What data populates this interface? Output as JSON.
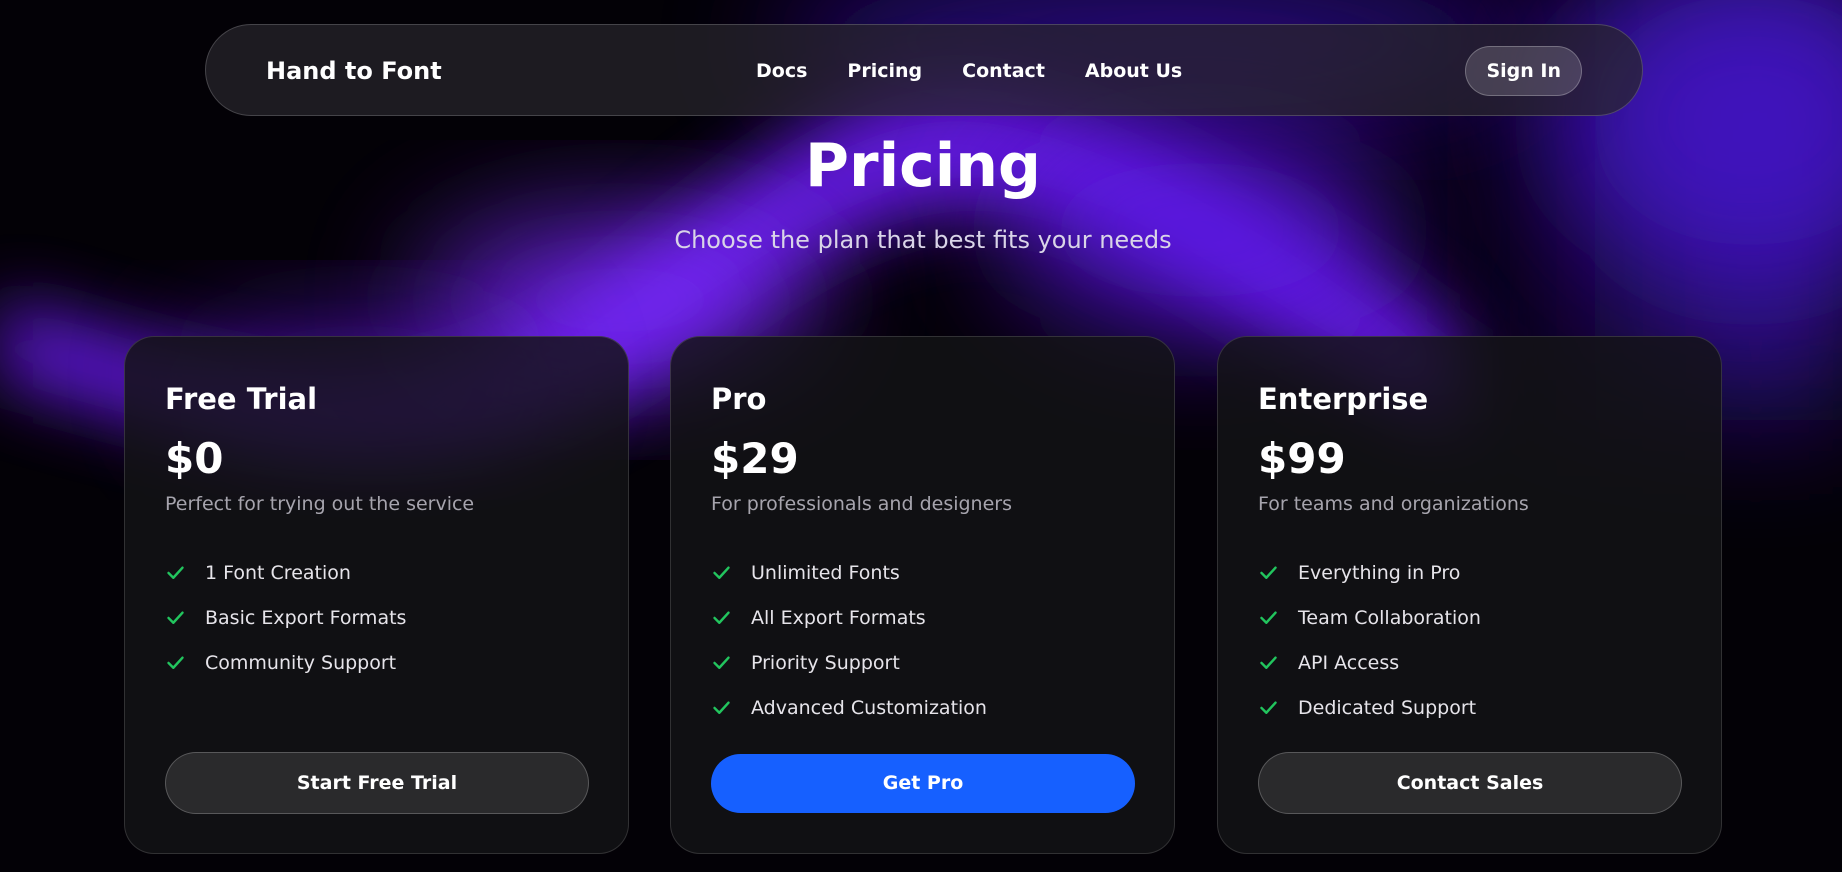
{
  "nav": {
    "brand": "Hand to Font",
    "links": [
      "Docs",
      "Pricing",
      "Contact",
      "About Us"
    ],
    "signin_label": "Sign In"
  },
  "hero": {
    "title": "Pricing",
    "subtitle": "Choose the plan that best fits your needs"
  },
  "plans": [
    {
      "name": "Free Trial",
      "price": "$0",
      "description": "Perfect for trying out the service",
      "features": [
        "1 Font Creation",
        "Basic Export Formats",
        "Community Support"
      ],
      "cta": "Start Free Trial"
    },
    {
      "name": "Pro",
      "price": "$29",
      "description": "For professionals and designers",
      "features": [
        "Unlimited Fonts",
        "All Export Formats",
        "Priority Support",
        "Advanced Customization"
      ],
      "cta": "Get Pro"
    },
    {
      "name": "Enterprise",
      "price": "$99",
      "description": "For teams and organizations",
      "features": [
        "Everything in Pro",
        "Team Collaboration",
        "API Access",
        "Dedicated Support"
      ],
      "cta": "Contact Sales"
    }
  ],
  "colors": {
    "accent": "#1660ff",
    "check": "#22c55e",
    "glow": "#6a1ff0"
  },
  "icons": {
    "feature": "check-icon"
  }
}
